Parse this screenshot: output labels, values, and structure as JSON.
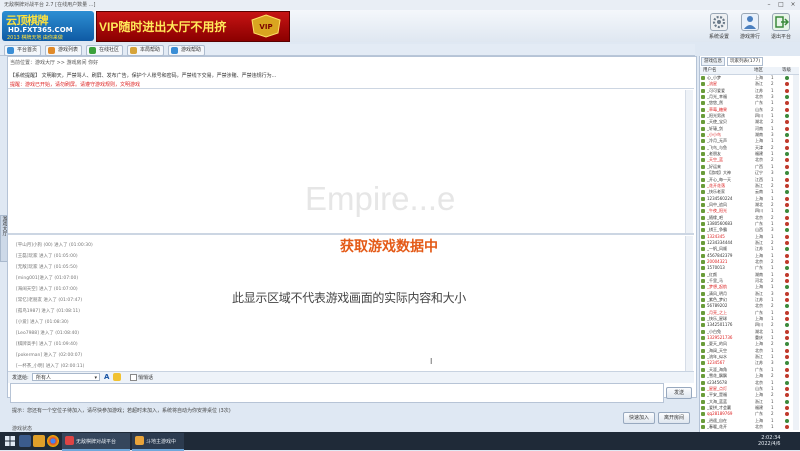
{
  "window": {
    "title": "无敌棋牌对战平台 2.7 [在线用户数量 ...]"
  },
  "logo": {
    "line1": "云顶棋牌",
    "line2": "HD.FXT365.COM",
    "line3": "2013 棋牌天地 由你来做"
  },
  "banner": {
    "text": "VIP随时进出大厅不用挤",
    "badge": "VIP"
  },
  "top_icons": [
    {
      "label": "系统设置",
      "icon": "gear-icon",
      "color": "#7a8a9a"
    },
    {
      "label": "游戏排行",
      "icon": "person-icon",
      "color": "#4a7fbf"
    },
    {
      "label": "退出平台",
      "icon": "exit-icon",
      "color": "#3b8a3b"
    }
  ],
  "nav_tabs": [
    {
      "label": "平台首页",
      "color": "#3a8ed6"
    },
    {
      "label": "游戏列表",
      "color": "#e08a2a"
    },
    {
      "label": "在线社区",
      "color": "#3ba13b"
    },
    {
      "label": "本局帮助",
      "color": "#d6a43a"
    },
    {
      "label": "游戏帮助",
      "color": "#3a8ed6"
    }
  ],
  "location": "当前位置：游戏大厅  >>  游戏房间 你好",
  "notice": "【系统提醒】 文明聊天，严禁骂人、刷屏、发布广告，保护个人账号和密码，严禁线下交易，严禁涉赌、严禁违规行为...",
  "notice2": "提醒：游戏已开始，请勿刷屏。请遵守游戏规则，文明游戏",
  "watermark": "Empire...e",
  "game_list": [
    "[平山月]小狗 (00) 进入了 (01:00:30)",
    "[王磊]玩家 进入了 (01:05:00)",
    "[无敌]玩家 进入了 (01:05:50)",
    "[ming001]进入了 (01:07:00)",
    "[海阔天空] 进入了 (01:07:00)",
    "[常忆]老朋友 进入了 (01:07:47)",
    "[孤鸟1987] 进入了 (01:08:11)",
    "[小爱] 进入了 (01:08:30)",
    "[Leo7988] 进入了 (01:08:40)",
    "[棋牌高手] 进入了 (01:09:40)",
    "[pokerman] 进入了 (02:00:07)",
    "[一杯茶_小明] 进入了 (02:00:11)",
    "[张三884] 进入了 (02:00:25)"
  ],
  "loading": "获取游戏数据中",
  "disclaimer": "此显示区域不代表游戏画面的实际内容和大小",
  "vtab_label": "游戏大厅",
  "chat": {
    "to_label": "发送给:",
    "target": "所有人",
    "check_label": "悄悄话",
    "send": "发送"
  },
  "status_text": "提示：您还有一个空位子待加入，请尽快参加游戏；若超时未加入，系统将自动为你安排桌位 (3次)",
  "buttons": {
    "quick": "快速加入",
    "exit": "离开房间"
  },
  "bottom_label": "游戏状态",
  "right_tabs": [
    "游戏信息",
    "玩家列表(177)"
  ],
  "user_header": {
    "name": "用户名",
    "area": "地区",
    "level": "等级"
  },
  "users": [
    {
      "name": "心_小梦",
      "area": "上海",
      "lvl": "1"
    },
    {
      "name": "_流星",
      "area": "浙江",
      "lvl": "2"
    },
    {
      "name": "_可可爱爱",
      "area": "江苏",
      "lvl": "1"
    },
    {
      "name": "_月光_幸福",
      "area": "北京",
      "lvl": "3"
    },
    {
      "name": "_悠悠_然",
      "area": "广东",
      "lvl": "1"
    },
    {
      "name": "_草莓_糖果",
      "area": "山东",
      "lvl": "2"
    },
    {
      "name": "_阳光男孩",
      "area": "四川",
      "lvl": "1"
    },
    {
      "name": "_天使_宝贝",
      "area": "湖北",
      "lvl": "2"
    },
    {
      "name": "_轩辕_剑",
      "area": "河南",
      "lvl": "1"
    },
    {
      "name": "_小小鸟",
      "area": "湖南",
      "lvl": "3"
    },
    {
      "name": "_冷月_无声",
      "area": "上海",
      "lvl": "1"
    },
    {
      "name": "_飞鸟_与鱼",
      "area": "天津",
      "lvl": "2"
    },
    {
      "name": "_老朋友",
      "area": "福建",
      "lvl": "1"
    },
    {
      "name": "_天空_蓝",
      "area": "北京",
      "lvl": "2"
    },
    {
      "name": "_好运来",
      "area": "广西",
      "lvl": "1"
    },
    {
      "name": "【游戏】大神",
      "area": "辽宁",
      "lvl": "3"
    },
    {
      "name": "_开心_每一天",
      "area": "江西",
      "lvl": "1"
    },
    {
      "name": "_花开花落",
      "area": "浙江",
      "lvl": "2"
    },
    {
      "name": "_快乐老家",
      "area": "云南",
      "lvl": "1"
    },
    {
      "name": "1234560224",
      "area": "上海",
      "lvl": "1"
    },
    {
      "name": "_风中_追风",
      "area": "湖北",
      "lvl": "2"
    },
    {
      "name": "_午夜_阳光",
      "area": "四川",
      "lvl": "1"
    },
    {
      "name": "_随缘_吧",
      "area": "北京",
      "lvl": "2"
    },
    {
      "name": "1380560683",
      "area": "广东",
      "lvl": "1"
    },
    {
      "name": "_棋王_争霸",
      "area": "山西",
      "lvl": "3"
    },
    {
      "name": "1324345",
      "area": "上海",
      "lvl": "1"
    },
    {
      "name": "1234334444",
      "area": "浙江",
      "lvl": "2"
    },
    {
      "name": "_一帆_风顺",
      "area": "江苏",
      "lvl": "1"
    },
    {
      "name": "4567842379",
      "area": "上海",
      "lvl": "1"
    },
    {
      "name": "20004321",
      "area": "北京",
      "lvl": "2"
    },
    {
      "name": "1570013",
      "area": "广东",
      "lvl": "1"
    },
    {
      "name": "_红颜",
      "area": "湖南",
      "lvl": "1"
    },
    {
      "name": "_千里_马",
      "area": "河北",
      "lvl": "2"
    },
    {
      "name": "_梦想_起航",
      "area": "上海",
      "lvl": "1"
    },
    {
      "name": "_清风_明月",
      "area": "浙江",
      "lvl": "3"
    },
    {
      "name": "_紫色_梦幻",
      "area": "江苏",
      "lvl": "1"
    },
    {
      "name": "56789202",
      "area": "北京",
      "lvl": "2"
    },
    {
      "name": "_月亮_之上",
      "area": "广东",
      "lvl": "1"
    },
    {
      "name": "_快乐_星球",
      "area": "上海",
      "lvl": "1"
    },
    {
      "name": "1342501176",
      "area": "四川",
      "lvl": "2"
    },
    {
      "name": "_小白兔",
      "area": "湖北",
      "lvl": "1"
    },
    {
      "name": "1329521736",
      "area": "重庆",
      "lvl": "1"
    },
    {
      "name": "_夏天_的风",
      "area": "上海",
      "lvl": "2"
    },
    {
      "name": "_海阔_天空",
      "area": "北京",
      "lvl": "1"
    },
    {
      "name": "_流年_似水",
      "area": "浙江",
      "lvl": "1"
    },
    {
      "name": "1234567",
      "area": "江苏",
      "lvl": "3"
    },
    {
      "name": "_天涯_海角",
      "area": "广东",
      "lvl": "1"
    },
    {
      "name": "_雪花_飘飘",
      "area": "上海",
      "lvl": "2"
    },
    {
      "name": "s2345678",
      "area": "北京",
      "lvl": "1"
    },
    {
      "name": "_星星_点灯",
      "area": "山东",
      "lvl": "1"
    },
    {
      "name": "_平安_是福",
      "area": "上海",
      "lvl": "2"
    },
    {
      "name": "_大海_蓝蓝",
      "area": "浙江",
      "lvl": "1"
    },
    {
      "name": "_爱拼_才会赢",
      "area": "福建",
      "lvl": "1"
    },
    {
      "name": "qq28189769",
      "area": "广东",
      "lvl": "2"
    },
    {
      "name": "_逍遥_自在",
      "area": "上海",
      "lvl": "1"
    },
    {
      "name": "_春暖_花开",
      "area": "北京",
      "lvl": "1"
    }
  ],
  "taskbar": {
    "win1": "无敌棋牌对战平台",
    "win2": "斗地主游戏中",
    "time": "2:02:34",
    "date": "2022/4/6"
  }
}
